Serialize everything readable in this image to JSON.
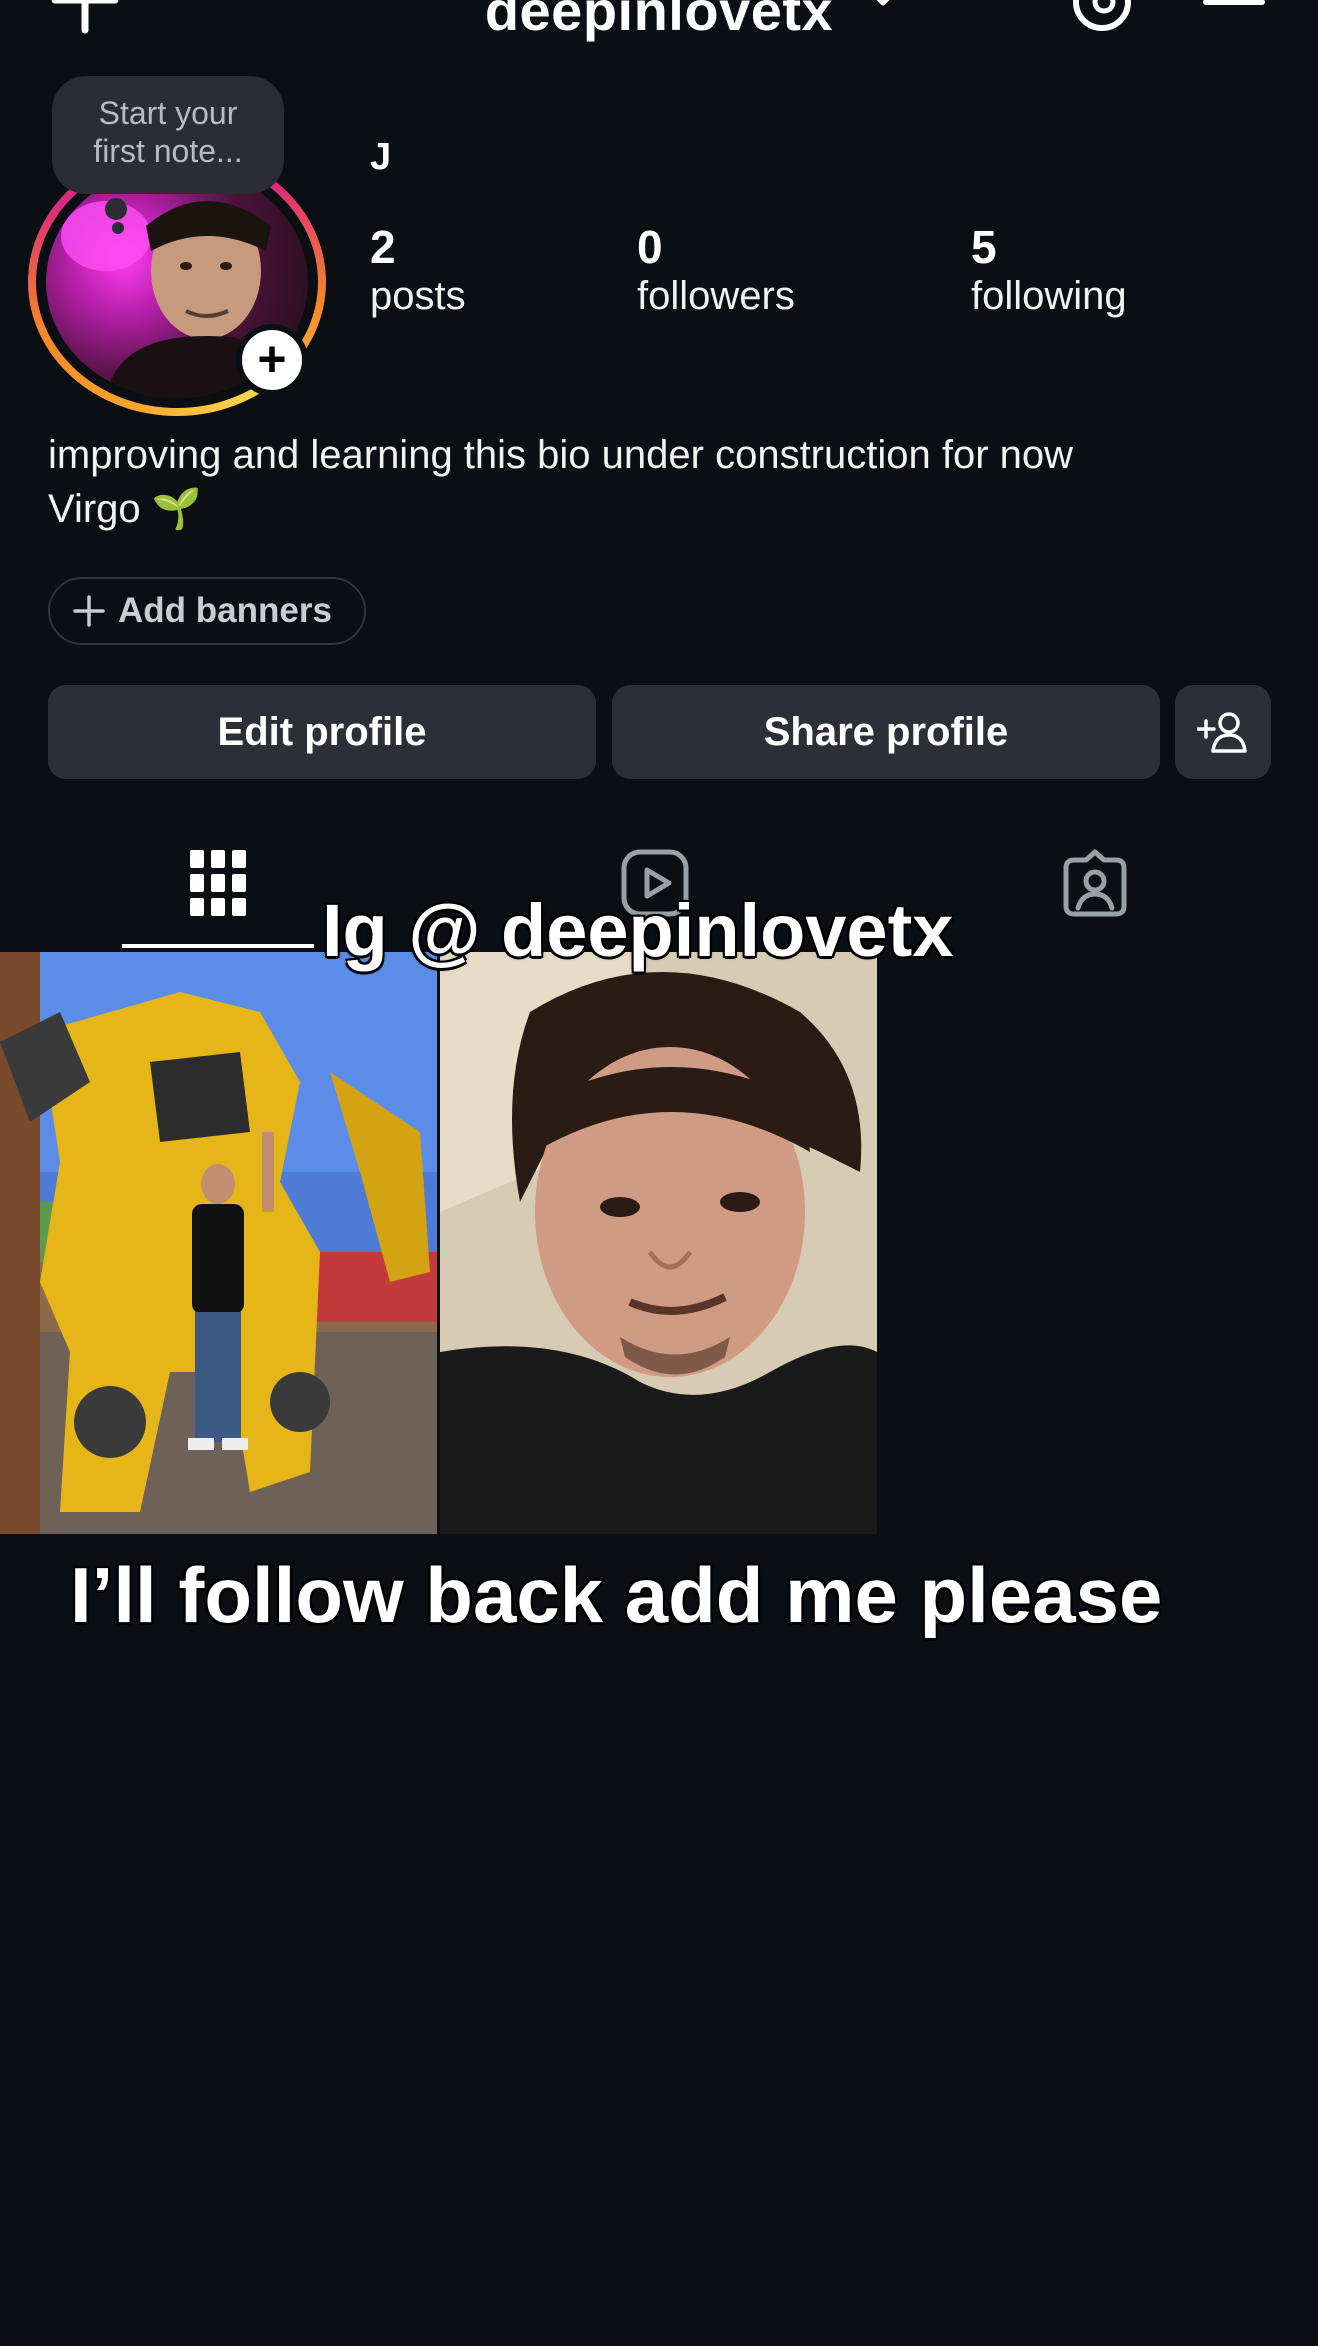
{
  "header": {
    "username": "deepinlovetx",
    "icons": [
      "plus-icon",
      "chevron-down-icon",
      "threads-icon",
      "menu-icon"
    ]
  },
  "note": {
    "placeholder_line1": "Start your",
    "placeholder_line2": "first note..."
  },
  "profile": {
    "display_name": "J",
    "stats": [
      {
        "count": "2",
        "label": "posts"
      },
      {
        "count": "0",
        "label": "followers"
      },
      {
        "count": "5",
        "label": "following"
      }
    ],
    "bio_line1": "improving and learning this bio under construction for now",
    "bio_line2": "Virgo 🌱",
    "add_banners_label": "Add banners"
  },
  "actions": {
    "edit_profile": "Edit profile",
    "share_profile": "Share profile"
  },
  "tabs": [
    "grid-icon",
    "reels-icon",
    "tagged-icon"
  ],
  "overlay": {
    "top_caption": "Ig @ deepinlovetx",
    "bottom_caption": "I’ll follow back add me please"
  },
  "colors": {
    "background": "#0b0f14",
    "button": "#2c3036",
    "story_ring": [
      "#f9a72b",
      "#dd2a7b",
      "#c32aa3"
    ]
  }
}
